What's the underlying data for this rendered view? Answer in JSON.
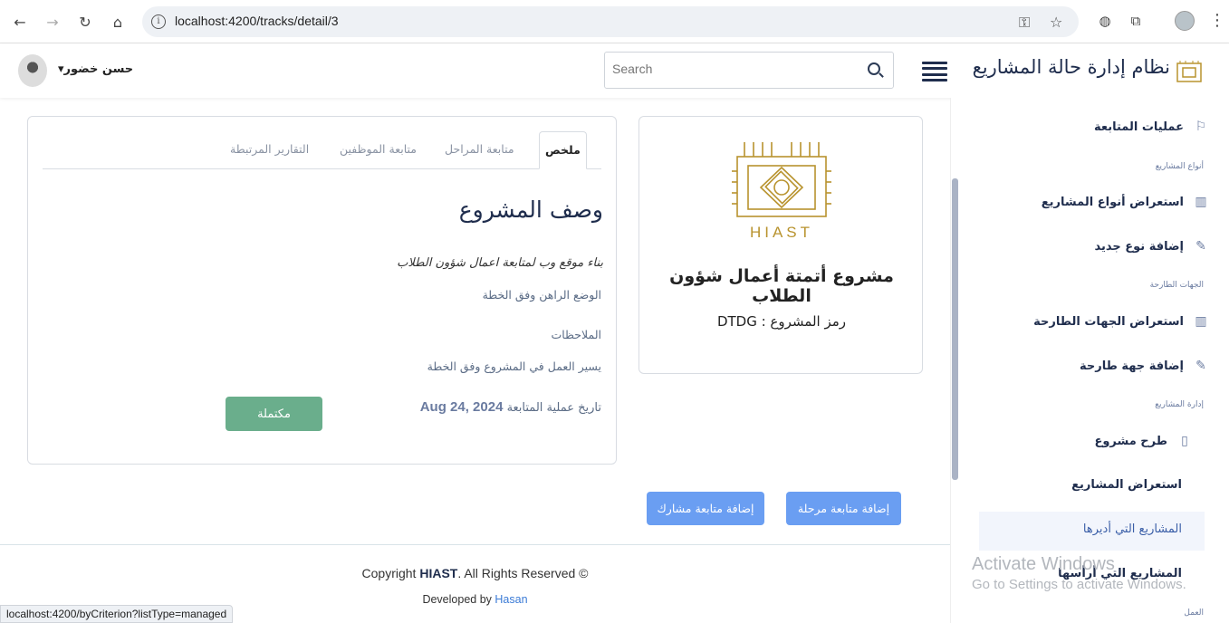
{
  "browser": {
    "url": "localhost:4200/tracks/detail/3",
    "status_url": "localhost:4200/byCriterion?listType=managed"
  },
  "header": {
    "app_title": "نظام إدارة حالة المشاريع",
    "search_placeholder": "Search",
    "user_name": "حسن خضور"
  },
  "sidebar": {
    "items": [
      {
        "label": "عمليات المتابعة",
        "icon": "flag-icon"
      },
      {
        "section": "أنواع المشاريع"
      },
      {
        "label": "استعراض أنواع المشاريع",
        "icon": "map-icon"
      },
      {
        "label": "إضافة نوع جديد",
        "icon": "pencil-icon"
      },
      {
        "section": "الجهات الطارحة"
      },
      {
        "label": "استعراض الجهات الطارحة",
        "icon": "map-icon"
      },
      {
        "label": "إضافة جهة طارحة",
        "icon": "pencil-icon"
      },
      {
        "section": "إدارة المشاريع"
      },
      {
        "label": "طرح مشروع",
        "icon": "document-icon"
      },
      {
        "label": "استعراض المشاريع"
      },
      {
        "label": "المشاريع التي أديرها",
        "active": true
      },
      {
        "label": "المشاريع التي أرأسها"
      },
      {
        "section": "العمل"
      }
    ]
  },
  "project": {
    "logo_text": "HIAST",
    "title": "مشروع أتمتة أعمال شؤون الطلاب",
    "code": "رمز المشروع : DTDG"
  },
  "summary": {
    "tabs": [
      "ملخص",
      "متابعة المراحل",
      "متابعة الموظفين",
      "التقارير المرتبطة"
    ],
    "section_title": "وصف المشروع",
    "description": "بناء موقع وب لمتابعة اعمال شؤون الطلاب",
    "status": "الوضع الراهن وفق الخطة",
    "notes_label": "الملاحظات",
    "notes": "يسير العمل في المشروع وفق الخطة",
    "date_label": "تاريخ عملية المتابعة",
    "date_value": "Aug 24, 2024",
    "complete_button": "مكتملة"
  },
  "actions": {
    "add_stage_follow": "إضافة متابعة مرحلة",
    "add_participant_follow": "إضافة متابعة مشارك"
  },
  "footer": {
    "copyright_pre": "Copyright",
    "copyright_brand": "HIAST",
    "copyright_post": ". All Rights Reserved ©",
    "developed_pre": "Developed by",
    "developer": "Hasan"
  },
  "watermark": {
    "line1": "Activate Windows",
    "line2": "Go to Settings to activate Windows."
  },
  "colors": {
    "navy": "#1f2d4d",
    "green_button": "#6aae8c",
    "blue_button": "#6a9ef2",
    "gold_logo": "#b8932e"
  }
}
